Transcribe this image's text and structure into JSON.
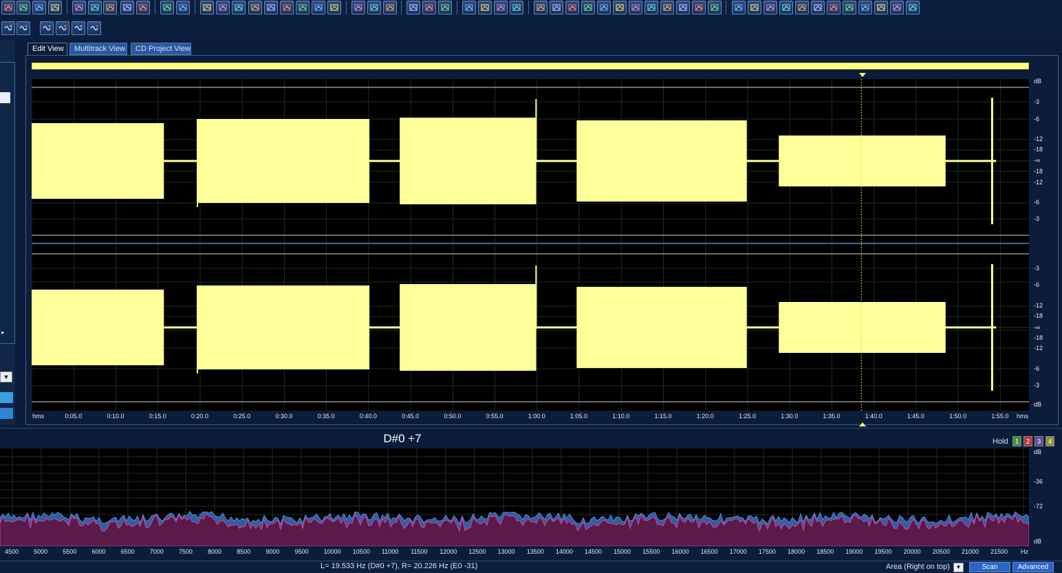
{
  "tabs": [
    {
      "label": "Edit View",
      "active": true
    },
    {
      "label": "Multitrack View",
      "active": false
    },
    {
      "label": "CD Project View",
      "active": false
    }
  ],
  "waveform": {
    "time_labels": [
      "hms",
      "0:05.0",
      "0:10.0",
      "0:15.0",
      "0:20.0",
      "0:25.0",
      "0:30.0",
      "0:35.0",
      "0:40.0",
      "0:45.0",
      "0:50.0",
      "0:55.0",
      "1:00.0",
      "1:05.0",
      "1:10.0",
      "1:15.0",
      "1:20.0",
      "1:25.0",
      "1:30.0",
      "1:35.0",
      "1:40.0",
      "1:45.0",
      "1:50.0",
      "1:55.0",
      "hms"
    ],
    "db_labels_ch1": [
      "dB",
      "-3",
      "-6",
      "-12",
      "-18",
      "-∞",
      "-18",
      "-12",
      "-6",
      "-3"
    ],
    "db_labels_ch2": [
      "-3",
      "-6",
      "-12",
      "-18",
      "-∞",
      "-18",
      "-12",
      "-6",
      "-3",
      "dB"
    ],
    "color": "#ffff99"
  },
  "spectrum": {
    "note_display": "D#0 +7",
    "hold_label": "Hold",
    "hold_buttons": [
      {
        "label": "1",
        "color": "#3f8f3f"
      },
      {
        "label": "2",
        "color": "#b03a3a"
      },
      {
        "label": "3",
        "color": "#5a4aa0"
      },
      {
        "label": "4",
        "color": "#8f8f3a"
      }
    ],
    "db_labels": [
      "dB",
      "-36",
      "-72",
      "dB"
    ],
    "freq_labels": [
      "4500",
      "5000",
      "5500",
      "6000",
      "6500",
      "7000",
      "7500",
      "8000",
      "8500",
      "9000",
      "9500",
      "10000",
      "10500",
      "11000",
      "11500",
      "12000",
      "12500",
      "13000",
      "13500",
      "14000",
      "14500",
      "15000",
      "15500",
      "16000",
      "16500",
      "17000",
      "17500",
      "18000",
      "18500",
      "19000",
      "19500",
      "20000",
      "20500",
      "21000",
      "21500",
      "Hz"
    ]
  },
  "status": {
    "readout": "L= 19.533 Hz (D#0 +7), R= 20.226 Hz (E0 -31)",
    "mode": "Area (Right on top)",
    "scan_label": "Scan",
    "advanced_label": "Advanced"
  }
}
